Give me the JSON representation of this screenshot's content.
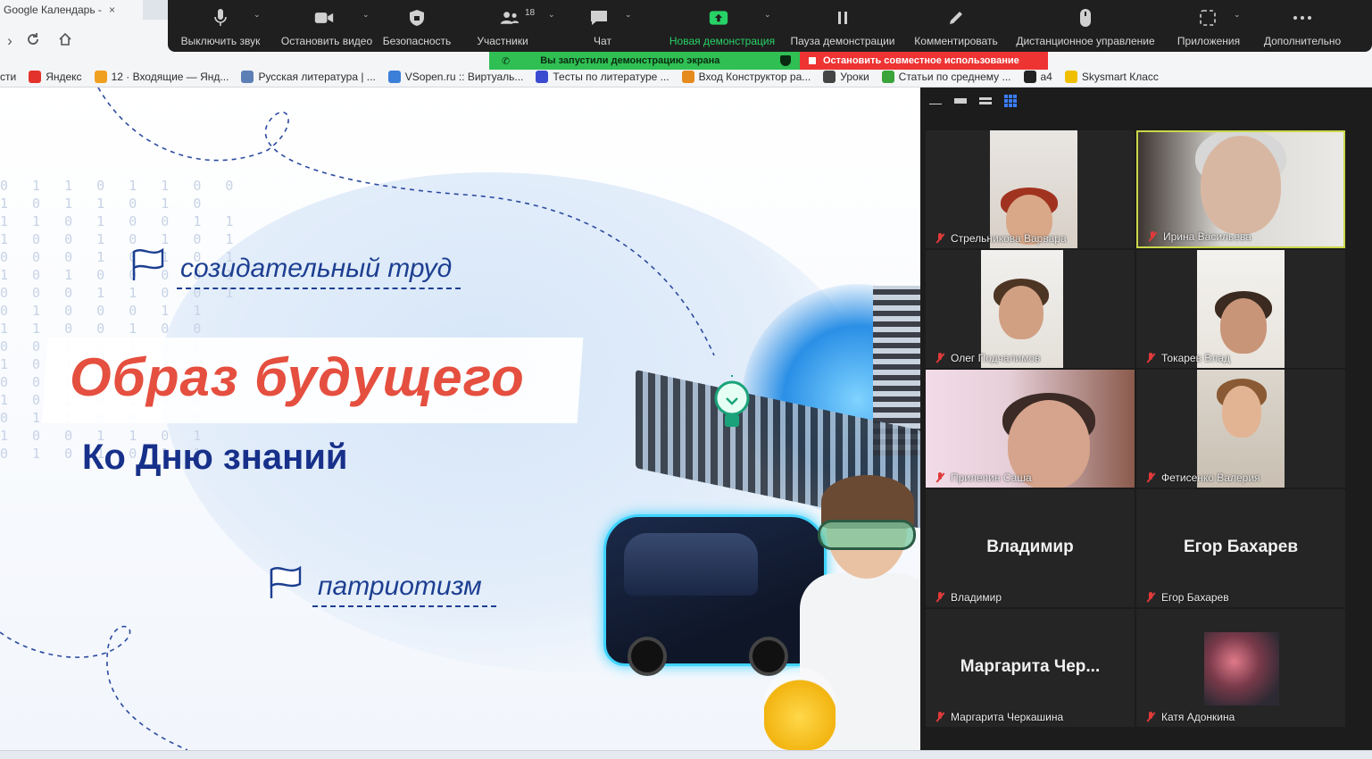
{
  "browser": {
    "tab_title": "Google Календарь -",
    "tab_close": "×",
    "bookmarks": [
      {
        "label": "сти",
        "color": "#8a8a8a"
      },
      {
        "label": "Яндекс",
        "color": "#e3322b"
      },
      {
        "label": "12 · Входящие — Янд...",
        "color": "#f0a020"
      },
      {
        "label": "Русская литература | ...",
        "color": "#5c7fb6"
      },
      {
        "label": "VSopen.ru :: Виртуаль...",
        "color": "#3c7fd8"
      },
      {
        "label": "Тесты по литературе ...",
        "color": "#3b4bd1"
      },
      {
        "label": "Вход Конструктор ра...",
        "color": "#e58a1d"
      },
      {
        "label": "Уроки",
        "color": "#444444"
      },
      {
        "label": "Статьи по среднему ...",
        "color": "#3aa33a"
      },
      {
        "label": "a4",
        "color": "#222222"
      },
      {
        "label": "Skysmart Класс",
        "color": "#f0c000"
      }
    ]
  },
  "toolbar": {
    "mute_label": "Выключить звук",
    "stop_video_label": "Остановить видео",
    "security_label": "Безопасность",
    "participants_label": "Участники",
    "participants_count": "18",
    "chat_label": "Чат",
    "new_share_label": "Новая демонстрация",
    "pause_share_label": "Пауза демонстрации",
    "annotate_label": "Комментировать",
    "remote_control_label": "Дистанционное управление",
    "apps_label": "Приложения",
    "more_label": "Дополнительно",
    "accent_green": "#27d266"
  },
  "share_banner": {
    "status_text": "Вы запустили демонстрацию экрана",
    "stop_text": "Остановить совместное использование",
    "green": "#2fbf53",
    "red": "#e33333"
  },
  "slide": {
    "tag_top": "созидательный труд",
    "title": "Образ будущего",
    "subtitle": "Ко Дню знаний",
    "tag_bottom": "патриотизм",
    "binary_rows": [
      "0 1 1 0 1 1 0 0",
      "1 0 1 1 0 1 0",
      "1 1 0 1 0 0 1 1",
      "1 0 0 1 0 1 0 1",
      "0 0 0 1 0 1 0 1",
      "1 0 1 0 0 0 0 1",
      "0 0 0 1 1 0 0 1",
      "0 1 0 0 0 1 1",
      "1 1 0 0 1 0 0",
      "0 0 1 0 1 0 1",
      "1 0 1 1 0 1 0",
      "0 0 1 1 0 0 1",
      "1 0 1 0 1 0 0",
      "0 1 1 0 0 1 0",
      "1 0 0 1 1 0 1",
      "0 1 0 1 0 1 1"
    ],
    "title_color": "#e54f3f",
    "subtitle_color": "#17308a"
  },
  "gallery": {
    "participants": [
      {
        "name": "Стрельникова Варвара",
        "has_video": true,
        "active": false,
        "big": ""
      },
      {
        "name": "Ирина Васильева",
        "has_video": true,
        "active": true,
        "big": ""
      },
      {
        "name": "Олег Подчалимов",
        "has_video": true,
        "active": false,
        "big": ""
      },
      {
        "name": "Токарев Влад",
        "has_video": true,
        "active": false,
        "big": ""
      },
      {
        "name": "Прилепин Саша",
        "has_video": true,
        "active": false,
        "big": ""
      },
      {
        "name": "Фетисенко Валерия",
        "has_video": true,
        "active": false,
        "big": ""
      },
      {
        "name": "Владимир",
        "has_video": false,
        "active": false,
        "big": "Владимир"
      },
      {
        "name": "Егор Бахарев",
        "has_video": false,
        "active": false,
        "big": "Егор Бахарев"
      },
      {
        "name": "Маргарита Черкашина",
        "has_video": false,
        "active": false,
        "big": "Маргарита Чер..."
      },
      {
        "name": "Катя Адонкина",
        "has_video": false,
        "active": false,
        "big": ""
      }
    ]
  }
}
